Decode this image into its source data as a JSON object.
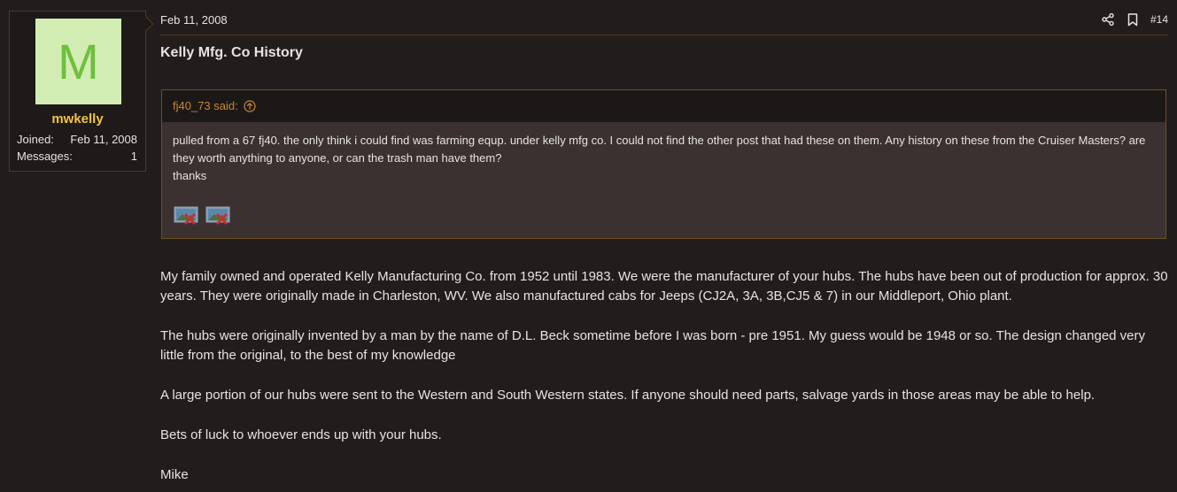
{
  "user": {
    "avatar_letter": "M",
    "name": "mwkelly",
    "joined_label": "Joined:",
    "joined_value": "Feb 11, 2008",
    "messages_label": "Messages:",
    "messages_value": "1"
  },
  "post": {
    "date": "Feb 11, 2008",
    "number": "#14",
    "title": "Kelly Mfg. Co History",
    "icons": [
      "share-icon",
      "bookmark-icon",
      "arrow-up-circle-icon",
      "broken-image-icon"
    ]
  },
  "quote": {
    "author_said": "fj40_73 said:",
    "lines": [
      "pulled from a 67 fj40. the only think i could find was farming equp. under kelly mfg co. I could not find the other post that had these on them. Any history on these from the Cruiser Masters? are they worth anything to anyone, or can the trash man have them?",
      "thanks"
    ]
  },
  "message": {
    "paragraphs": [
      "My family owned and operated Kelly Manufacturing Co. from 1952 until 1983. We were the manufacturer of your hubs. The hubs have been out of production for approx. 30 years. They were originally made in Charleston, WV. We also manufactured cabs for Jeeps (CJ2A, 3A, 3B,CJ5 & 7) in our Middleport, Ohio plant.",
      "The hubs were originally invented by a man by the name of D.L. Beck sometime before I was born - pre 1951. My guess would be 1948 or so. The design changed very little from the original, to the best of my knowledge",
      "A large portion of our hubs were sent to the Western and South Western states. If anyone should need parts, salvage yards in those areas may be able to help.",
      "Bets of luck to whoever ends up with your hubs.",
      "Mike"
    ]
  },
  "colors": {
    "background": "#221d1c",
    "username": "#f1c342",
    "quote_author": "#c7862f",
    "border": "#4d3a1e",
    "avatar_bg": "#d2edb3",
    "avatar_fg": "#6fbf3e"
  }
}
